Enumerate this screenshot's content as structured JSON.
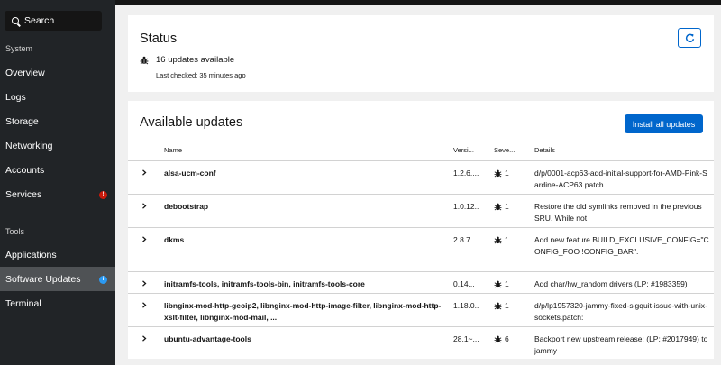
{
  "sidebar": {
    "search_label": "Search",
    "section_system": "System",
    "section_tools": "Tools",
    "items": [
      {
        "label": "Overview"
      },
      {
        "label": "Logs"
      },
      {
        "label": "Storage"
      },
      {
        "label": "Networking"
      },
      {
        "label": "Accounts"
      },
      {
        "label": "Services",
        "badge": "!"
      },
      {
        "label": "Applications"
      },
      {
        "label": "Software Updates",
        "badge": "i"
      },
      {
        "label": "Terminal"
      }
    ]
  },
  "status": {
    "title": "Status",
    "summary": "16 updates available",
    "last_checked": "Last checked: 35 minutes ago"
  },
  "updates": {
    "title": "Available updates",
    "install_label": "Install all updates",
    "columns": {
      "name": "Name",
      "version": "Versi...",
      "severity": "Seve...",
      "details": "Details"
    },
    "rows": [
      {
        "name": "alsa-ucm-conf",
        "version": "1.2.6....",
        "severity": "1",
        "details": "d/p/0001-acp63-add-initial-support-for-AMD-Pink-Sardine-ACP63.patch"
      },
      {
        "name": "debootstrap",
        "version": "1.0.12...",
        "severity": "1",
        "details": "Restore the old symlinks removed in the previous SRU. While not"
      },
      {
        "name": "dkms",
        "version": "2.8.7...",
        "severity": "1",
        "details": "Add new feature BUILD_EXCLUSIVE_CONFIG=\"CONFIG_FOO !CONFIG_BAR\"."
      },
      {
        "name": "initramfs-tools, initramfs-tools-bin, initramfs-tools-core",
        "version": "0.14...",
        "severity": "1",
        "details": "Add char/hw_random drivers (LP: #1983359)"
      },
      {
        "name": "libnginx-mod-http-geoip2, libnginx-mod-http-image-filter, libnginx-mod-http-xslt-filter, libnginx-mod-mail, ...",
        "version": "1.18.0...",
        "severity": "1",
        "details": "d/p/lp1957320-jammy-fixed-sigquit-issue-with-unix-sockets.patch:"
      },
      {
        "name": "ubuntu-advantage-tools",
        "version": "28.1~...",
        "severity": "6",
        "details": "Backport new upstream release: (LP: #2017949) to jammy"
      }
    ]
  }
}
